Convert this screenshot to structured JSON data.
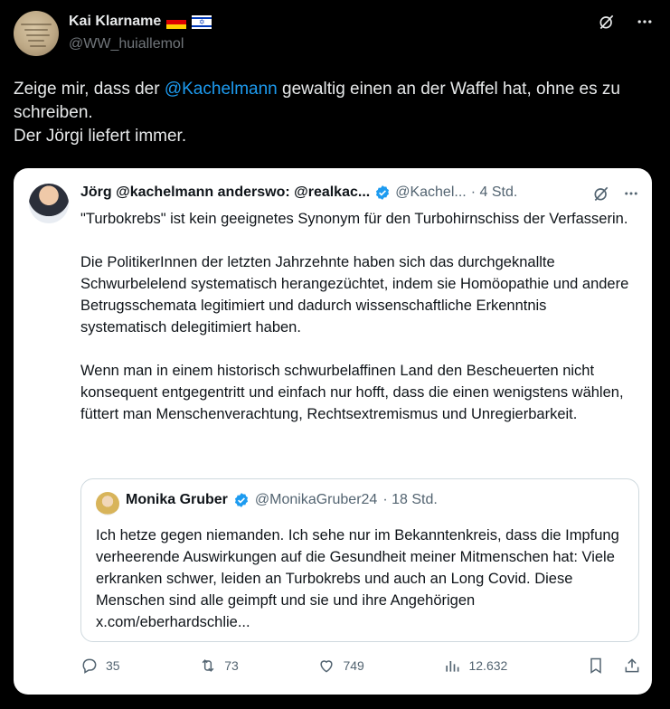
{
  "post": {
    "author_name": "Kai Klarname",
    "author_handle": "@WW_huiallemol",
    "text_before_mention": "Zeige mir, dass der ",
    "mention": "@Kachelmann",
    "text_after_mention": " gewaltig einen an der Waffel hat, ohne es zu schreiben.",
    "text_line3": "Der Jörgi liefert immer."
  },
  "quoted": {
    "author_name": "Jörg @kachelmann anderswo: @realkac...",
    "handle": "@Kachel...",
    "time": "· 4 Std.",
    "paragraphs": [
      "\"Turbokrebs\" ist kein geeignetes Synonym für den Turbohirnschiss der Verfasserin.",
      "Die PolitikerInnen der letzten Jahrzehnte haben sich das durchgeknallte Schwurbelelend systematisch herangezüchtet, indem sie Homöopathie und andere Betrugsschemata legitimiert und dadurch wissenschaftliche Erkenntnis systematisch delegitimiert haben.",
      "Wenn man in einem historisch schwurbelaffinen Land den Bescheuerten nicht konsequent entgegentritt und einfach nur hofft, dass die einen wenigstens wählen, füttert man Menschenverachtung, Rechtsextremismus und Unregierbarkeit."
    ],
    "inner": {
      "author_name": "Monika Gruber",
      "handle": "@MonikaGruber24",
      "time": "· 18 Std.",
      "text": "Ich hetze gegen niemanden. Ich sehe nur im Bekanntenkreis, dass die Impfung verheerende Auswirkungen auf die Gesundheit meiner Mitmenschen hat: Viele erkranken schwer, leiden an Turbokrebs und auch an Long Covid. Diese Menschen sind alle geimpft und sie und ihre Angehörigen x.com/eberhardschlie..."
    },
    "stats": {
      "replies": "35",
      "reposts": "73",
      "likes": "749",
      "views": "12.632"
    }
  },
  "colors": {
    "background": "#000000",
    "link": "#1d9bf0",
    "verified": "#1d9bf0",
    "card": "#ffffff"
  }
}
